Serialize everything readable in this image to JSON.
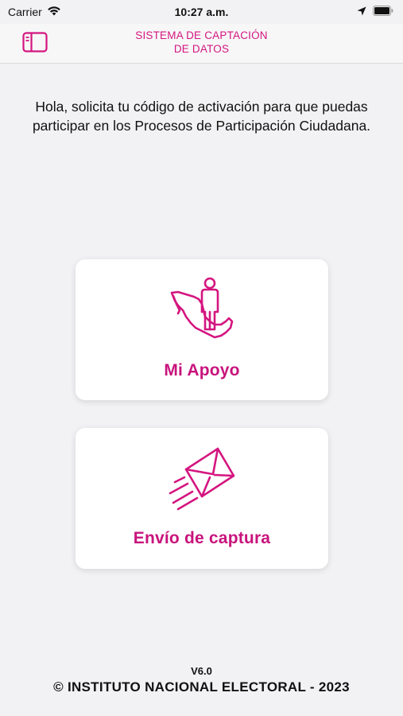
{
  "status": {
    "carrier": "Carrier",
    "time": "10:27 a.m."
  },
  "nav": {
    "title_line1": "SISTEMA DE CAPTACIÓN",
    "title_line2": "DE DATOS",
    "sidebar_icon": "sidebar-icon"
  },
  "intro_text": "Hola, solicita tu código de activación para que puedas participar en los Procesos de Participación Ciudadana.",
  "cards": [
    {
      "label": "Mi Apoyo",
      "icon": "map-person-icon"
    },
    {
      "label": "Envío de captura",
      "icon": "send-envelope-icon"
    }
  ],
  "version": "V6.0",
  "footer": "© INSTITUTO NACIONAL ELECTORAL - 2023",
  "colors": {
    "accent": "#d4157f",
    "background": "#f2f2f4"
  }
}
